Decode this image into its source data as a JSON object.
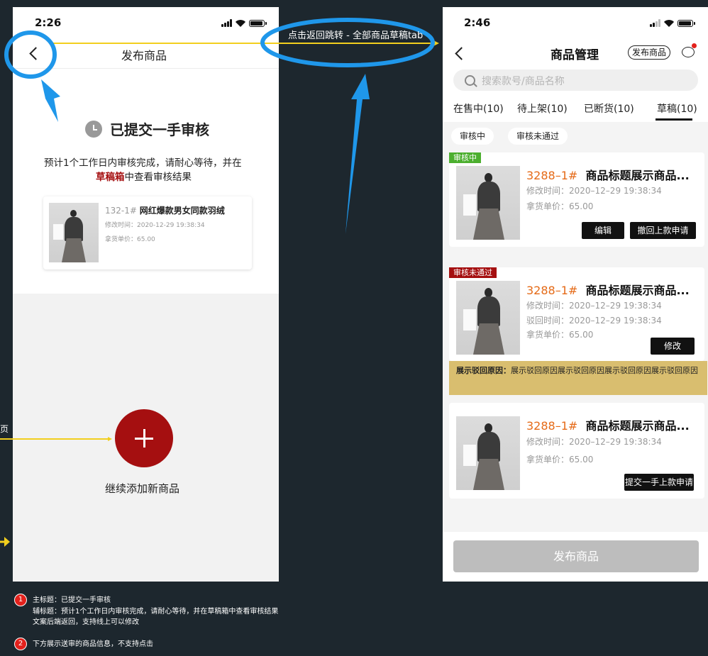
{
  "colors": {
    "accent_red": "#a50f10",
    "code_orange": "#e56a17",
    "tag_green": "#4caf2f",
    "tag_red": "#a50f10",
    "reject_bg": "#d9be6f",
    "annotation_blue": "#1f97ea",
    "annotation_yellow": "#f2cf1e"
  },
  "left_phone": {
    "status_time": "2:26",
    "nav_title": "发布商品",
    "status_title": "已提交一手审核",
    "subtitle_line1": "预计1个工作日内审核完成，请耐心等待，并在",
    "subtitle_highlight": "草稿箱",
    "subtitle_line2_rest": "中查看审核结果",
    "product": {
      "code": "132-1#",
      "name": "网红爆款男女同款羽绒",
      "modified": "修改时间：2020-12-29 19:38:34",
      "price": "拿货单价：65.00"
    },
    "add_label": "继续添加新商品"
  },
  "right_phone": {
    "status_time": "2:46",
    "nav_title": "商品管理",
    "publish_pill": "发布商品",
    "search_placeholder": "搜索款号/商品名称",
    "tabs": [
      {
        "label": "在售中(10)"
      },
      {
        "label": "待上架(10)"
      },
      {
        "label": "已断货(10)"
      },
      {
        "label": "草稿(10)"
      }
    ],
    "filters": [
      {
        "label": "审核中"
      },
      {
        "label": "审核未通过"
      }
    ],
    "cards": [
      {
        "tag": "审核中",
        "code": "3288–1#",
        "title": "商品标题展示商品...",
        "lines": [
          "修改时间：2020–12–29 19:38:34",
          "拿货单价：65.00"
        ],
        "buttons": [
          "编辑",
          "撤回上款申请"
        ]
      },
      {
        "tag": "审核未通过",
        "code": "3288–1#",
        "title": "商品标题展示商品...",
        "lines": [
          "修改时间：2020–12–29 19:38:34",
          "驳回时间：2020–12–29 19:38:34",
          "拿货单价：65.00"
        ],
        "buttons": [
          "修改"
        ],
        "reject_label": "展示驳回原因：",
        "reject_text": "展示驳回原因展示驳回原因展示驳回原因展示驳回原因"
      },
      {
        "code": "3288–1#",
        "title": "商品标题展示商品...",
        "lines": [
          "修改时间：2020–12–29 19:38:34",
          "拿货单价：65.00"
        ],
        "buttons": [
          "提交一手上款申请"
        ]
      }
    ],
    "bottom_button": "发布商品"
  },
  "annotations": {
    "top_arrow_label": "点击返回跳转 - 全部商品草稿tab",
    "left_edge_fragment": "页",
    "notes": [
      {
        "num": "1",
        "lines": [
          "主标题：已提交一手审核",
          "辅标题：预计1个工作日内审核完成，请耐心等待，并在草稿箱中查看审核结果",
          "文案后端返回，支持线上可以修改"
        ]
      },
      {
        "num": "2",
        "lines": [
          "下方展示送审的商品信息，不支持点击"
        ]
      }
    ]
  }
}
